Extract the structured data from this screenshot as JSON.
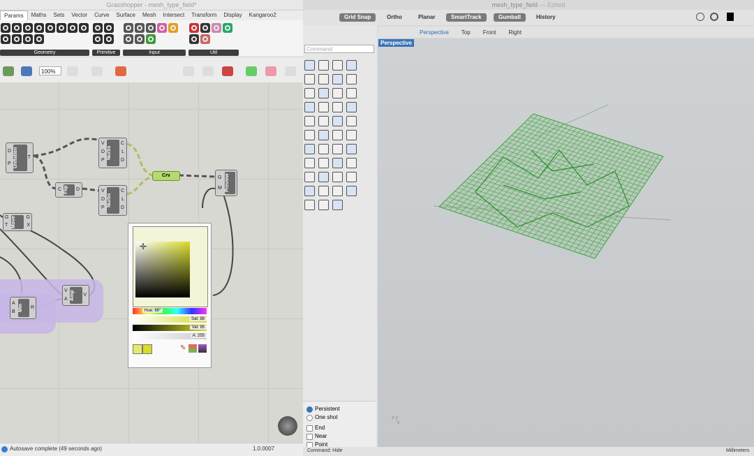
{
  "grasshopper": {
    "title": "Grasshopper - mesh_type_field*",
    "tabs": [
      "Params",
      "Maths",
      "Sets",
      "Vector",
      "Curve",
      "Surface",
      "Mesh",
      "Intersect",
      "Transform",
      "Display",
      "Kangaroo2"
    ],
    "ribbon_groups": [
      "Geometry",
      "Primitive",
      "Input",
      "Util"
    ],
    "zoom": "100%",
    "components": {
      "unflatten": {
        "label": "Unflatten",
        "in": [
          "D",
          "P"
        ],
        "out": "T"
      },
      "nurbs1": {
        "label": "Nurbs",
        "in": [
          "V",
          "D",
          "P"
        ],
        "out": [
          "C",
          "L",
          "D"
        ]
      },
      "flip": {
        "label": "Flip",
        "in": [
          "C"
        ],
        "out": "D"
      },
      "nurbs2": {
        "label": "Nurbs",
        "in": [
          "V",
          "D",
          "P"
        ],
        "out": [
          "C",
          "L",
          "D"
        ]
      },
      "crv": {
        "label": "Crv"
      },
      "preview": {
        "label": "Preview",
        "in": [
          "G",
          "M"
        ]
      },
      "move": {
        "label": "Move",
        "in": [
          "G",
          "T"
        ],
        "out": [
          "G",
          "X"
        ]
      },
      "amp": {
        "label": "Amp",
        "in": [
          "V",
          "A"
        ],
        "out": "V"
      },
      "min": {
        "label": "Min",
        "in": [
          "A",
          "B"
        ],
        "out": "R"
      }
    },
    "swatch": {
      "hue": "Hue: 66°",
      "sat": "Sat: 88",
      "val": "Val: 95",
      "alpha": "A: 255"
    },
    "status": "Autosave complete (49 seconds ago)",
    "version": "1.0.0007"
  },
  "rhino": {
    "title": "mesh_type_field",
    "edited": "— Edited",
    "toggles": [
      {
        "label": "Grid Snap",
        "on": true
      },
      {
        "label": "Ortho",
        "on": false
      },
      {
        "label": "Planar",
        "on": false
      },
      {
        "label": "SmartTrack",
        "on": true
      },
      {
        "label": "Gumball",
        "on": true
      },
      {
        "label": "History",
        "on": false
      }
    ],
    "command_placeholder": "Command",
    "viewport_tabs": [
      "Perspective",
      "Top",
      "Front",
      "Right"
    ],
    "active_viewport": "Perspective",
    "osnap_options": [
      "Persistent",
      "One shot",
      "End",
      "Near",
      "Point"
    ],
    "command_line": "Command: Hide",
    "units": "Millimeters",
    "mesh_color": "#3ea63e"
  }
}
